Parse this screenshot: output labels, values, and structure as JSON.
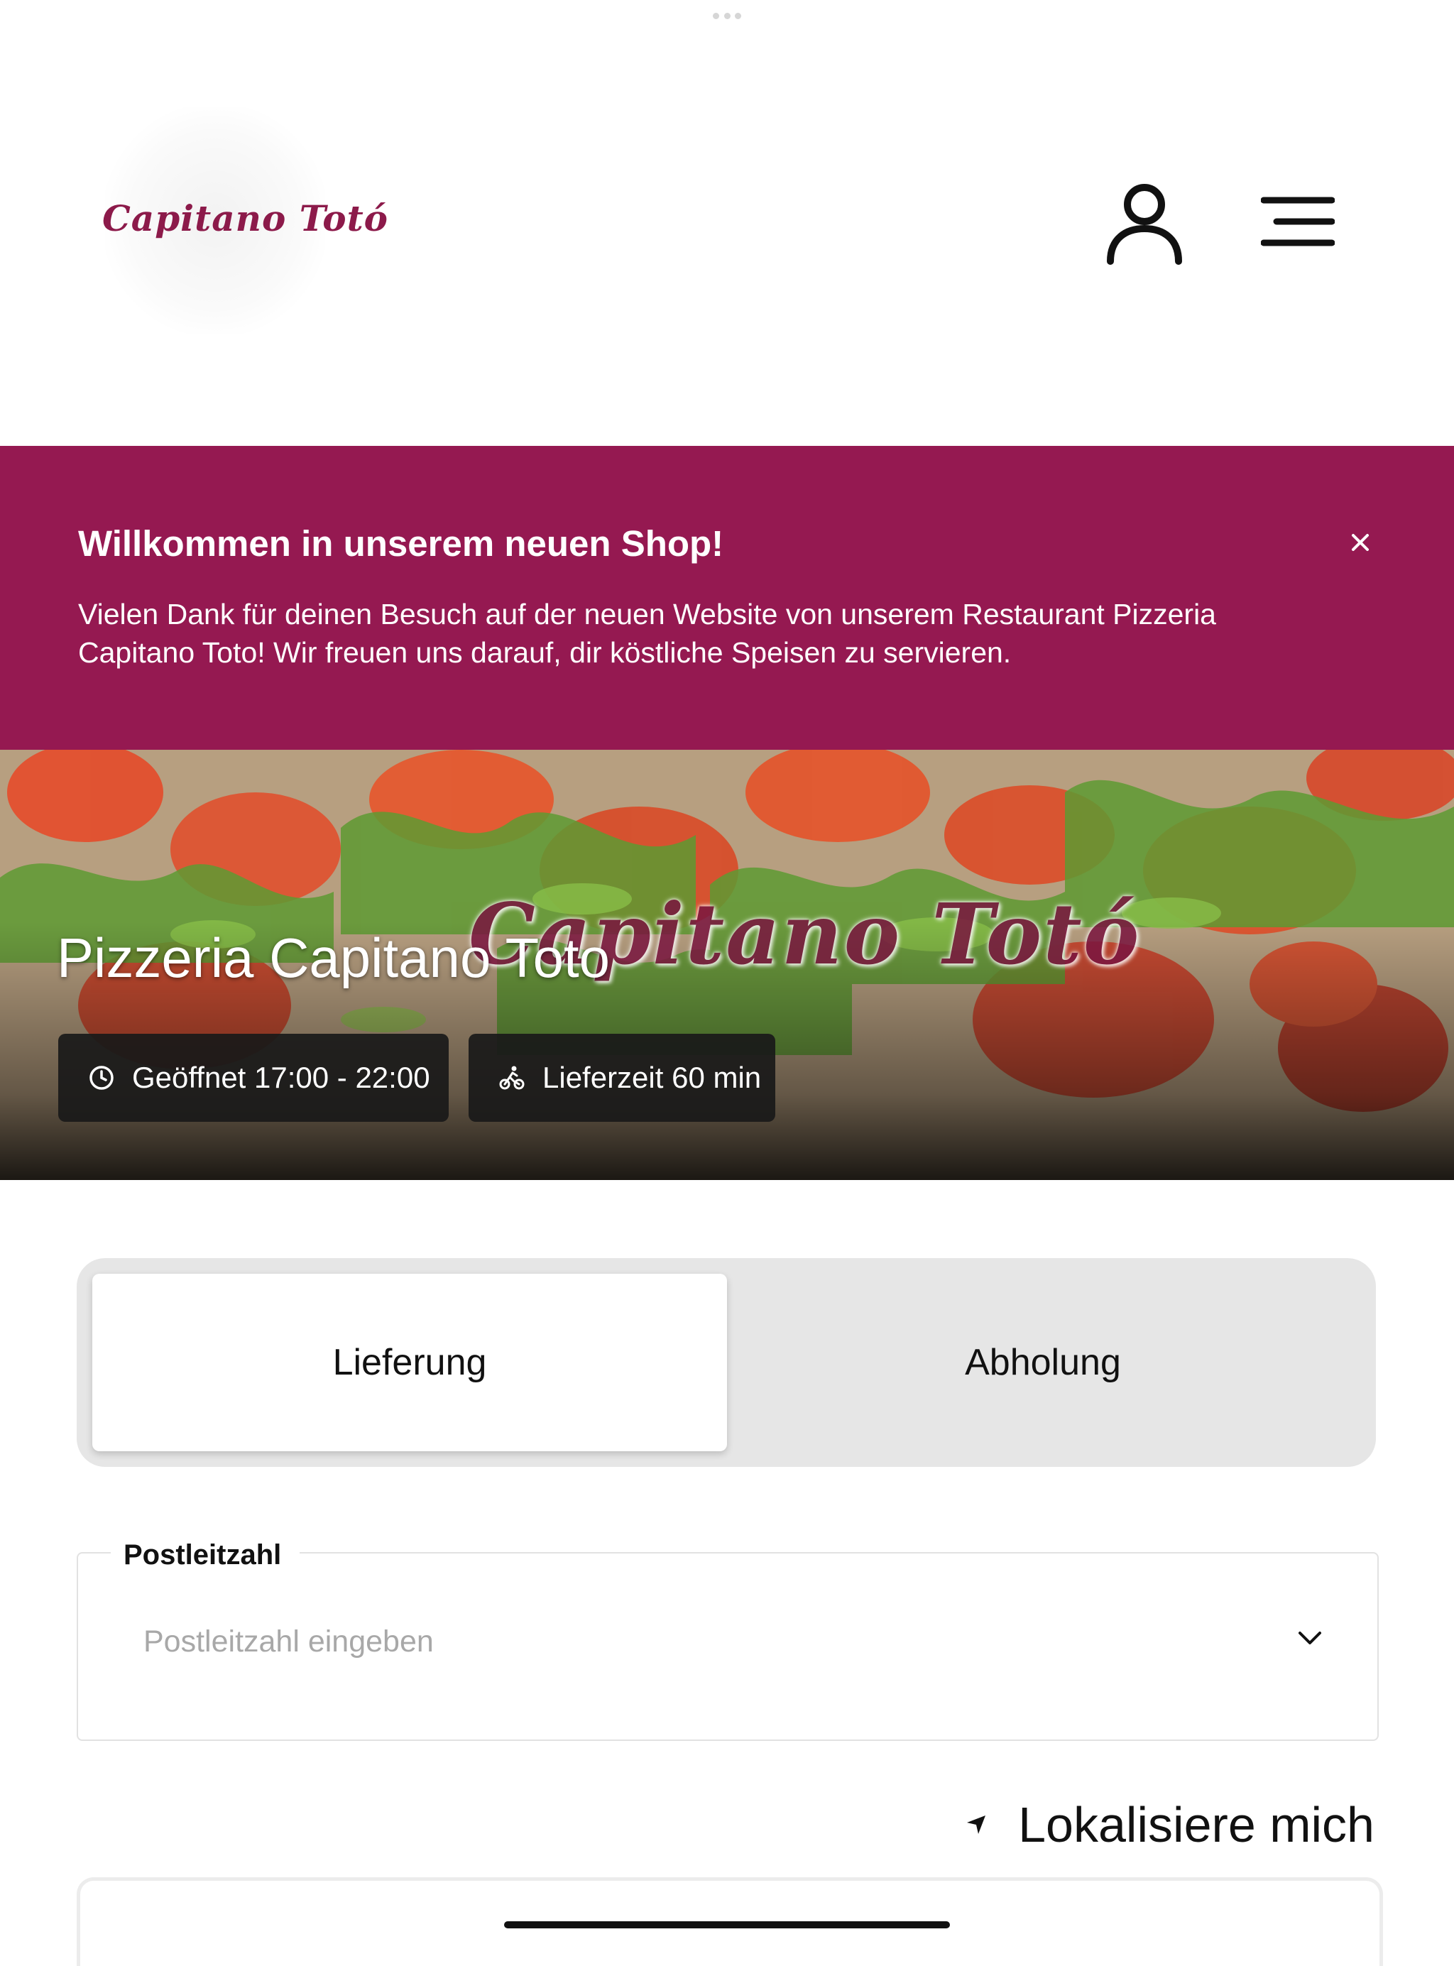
{
  "header": {
    "logo_text": "Capitano Totó",
    "user_icon": "user-icon",
    "menu_icon": "hamburger-menu-icon"
  },
  "banner": {
    "title": "Willkommen in unserem neuen Shop!",
    "text": "Vielen Dank für deinen Besuch auf der neuen Website von unserem Restaurant Pizzeria Capitano Toto! Wir freuen uns darauf, dir köstliche Speisen zu servieren.",
    "close_icon": "close-icon",
    "background_color": "#951951"
  },
  "hero": {
    "brand_overlay": "Capitano Totó",
    "title": "Pizzeria Capitano Toto",
    "opening_hours": "Geöffnet 17:00 - 22:00",
    "delivery_time": "Lieferzeit 60 min"
  },
  "order_mode": {
    "tabs": [
      "Lieferung",
      "Abholung"
    ],
    "selected": "Lieferung"
  },
  "postal": {
    "label": "Postleitzahl",
    "placeholder": "Postleitzahl eingeben",
    "value": ""
  },
  "locate": {
    "label": "Lokalisiere mich"
  }
}
